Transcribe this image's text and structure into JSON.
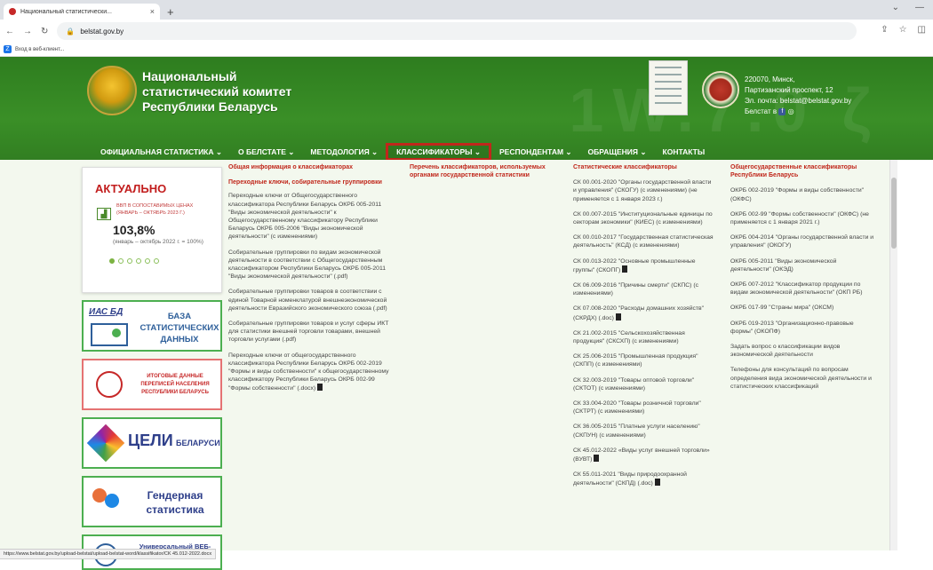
{
  "browser": {
    "tab_title": "Национальный статистически...",
    "tab_close": "×",
    "new_tab": "+",
    "url": "belstat.gov.by",
    "bookmark": "Вход в веб-клиент..."
  },
  "header": {
    "site_title": "Национальный статистический комитет Республики Беларусь",
    "address_line1": "220070, Минск,",
    "address_line2": "Партизанский проспект, 12",
    "email_line": "Эл. почта: belstat@belstat.gov.by",
    "social_line": "Белстат в"
  },
  "nav": {
    "items": [
      {
        "label": "ОФИЦИАЛЬНАЯ СТАТИСТИКА ⌄"
      },
      {
        "label": "О БЕЛСТАТЕ ⌄"
      },
      {
        "label": "МЕТОДОЛОГИЯ ⌄"
      },
      {
        "label": "КЛАССИФИКАТОРЫ ⌄"
      },
      {
        "label": "РЕСПОНДЕНТАМ ⌄"
      },
      {
        "label": "ОБРАЩЕНИЯ ⌄"
      },
      {
        "label": "КОНТАКТЫ"
      }
    ]
  },
  "aside": {
    "actual_title": "АКТУАЛЬНО",
    "kpi_caption": "ВВП В СОПОСТАВИМЫХ ЦЕНАХ (ЯНВАРЬ – ОКТЯБРЬ 2023 Г.)",
    "kpi_value": "103,8%",
    "kpi_note": "(январь – октябрь 2022 г. = 100%)",
    "banner1_tag": "ИАС БД",
    "banner1_text": "БАЗА СТАТИСТИЧЕСКИХ ДАННЫХ",
    "banner2_text": "ИТОГОВЫЕ ДАННЫЕ ПЕРЕПИСЕЙ НАСЕЛЕНИЯ РЕСПУБЛИКИ БЕЛАРУСЬ",
    "banner3_text": "ЦЕЛИ",
    "banner3_sub": "БЕЛАРУСИ",
    "banner4_text": "Гендерная статистика",
    "banner5_text": "Универсальный ВЕБ-ПОРТАЛ"
  },
  "col1": {
    "header": "Общая информация о классификаторах",
    "sub": "Переходные ключи, собирательные группировки",
    "items": [
      "Переходные ключи от Общегосударственного классификатора Республики Беларусь ОКРБ 005-2011 \"Виды экономической деятельности\" к Общегосударственному классификатору Республики Беларусь ОКРБ 005-2006 \"Виды экономической деятельности\" (с изменениями)",
      "Собирательные группировки по видам экономической деятельности в соответствии с Общегосударственным классификатором Республики Беларусь ОКРБ 005-2011 \"Виды экономической деятельности\" (.pdf)",
      "Собирательные группировки товаров в соответствии с единой Товарной номенклатурой внешнеэкономической деятельности Евразийского экономического союза (.pdf)",
      "Собирательные группировки товаров и услуг сферы ИКТ для статистики внешней торговли товарами, внешней торговли услугами (.pdf)",
      "Переходные ключи от общегосударственного классификатора Республики Беларусь ОКРБ 002-2019 \"Формы и виды собственности\" к общегосударственному классификатору Республики Беларусь ОКРБ 002-99 \"Формы собственности\" (.docx)"
    ]
  },
  "col2": {
    "header": "Перечень классификаторов, используемых органами государственной статистики"
  },
  "col3": {
    "header": "Статистические классификаторы",
    "items": [
      "СК 00.001-2020 \"Органы государственной власти и управления\" (СКОГУ) (с изменениями) (не применяется с 1 января 2023 г.)",
      "СК 00.007-2015 \"Институциональные единицы по секторам экономики\" (КИЕС) (с изменениями)",
      "СК 00.010-2017 \"Государственная статистическая деятельность\" (КСД) (с изменениями)",
      "СК 00.013-2022 \"Основные промышленные группы\" (СКОПГ)",
      "СК 06.009-2016 \"Причины смерти\" (СКПС) (с изменениями)",
      "СК 07.008-2020 \"Расходы домашних хозяйств\" (СКРДХ) (.doc)",
      "СК 21.002-2015 \"Сельскохозяйственная продукция\" (СКСХП) (с изменениями)",
      "СК 25.006-2015 \"Промышленная продукция\" (СКПП) (с изменениями)",
      "СК 32.003-2019 \"Товары оптовой торговли\" (СКТОТ) (с изменениями)",
      "СК 33.004-2020 \"Товары розничной торговли\" (СКТРТ) (с изменениями)",
      "СК 36.005-2015 \"Платные услуги населению\" (СКПУН) (с изменениями)",
      "СК 45.012-2022 «Виды услуг внешней торговли» (ВУВТ)",
      "СК 55.011-2021 \"Виды природоохранной деятельности\" (СКПД) (.doc)"
    ]
  },
  "col4": {
    "header": "Общегосударственные классификаторы Республики Беларусь",
    "items": [
      "ОКРБ 002-2019 \"Формы и виды собственности\" (ОКФС)",
      "ОКРБ 002-99 \"Формы собственности\" (ОКФС) (не применяется с 1 января 2021 г.)",
      "ОКРБ 004-2014 \"Органы государственной власти и управления\" (ОКОГУ)",
      "ОКРБ 005-2011 \"Виды экономической деятельности\" (ОКЭД)",
      "ОКРБ 007-2012 \"Классификатор продукции по видам экономической деятельности\" (ОКП РБ)",
      "ОКРБ 017-99 \"Страны мира\" (ОКСМ)",
      "ОКРБ 019-2013 \"Организационно-правовые формы\" (ОКОПФ)",
      "Задать вопрос о классификации видов экономической деятельности",
      "Телефоны для консультаций по вопросам определения вида экономической деятельности и статистических классификаций"
    ]
  },
  "status_bar": "https://www.belstat.gov.by/upload-belstat/upload-belstat-word/klassifikator/CK 45.012-2022.docx"
}
